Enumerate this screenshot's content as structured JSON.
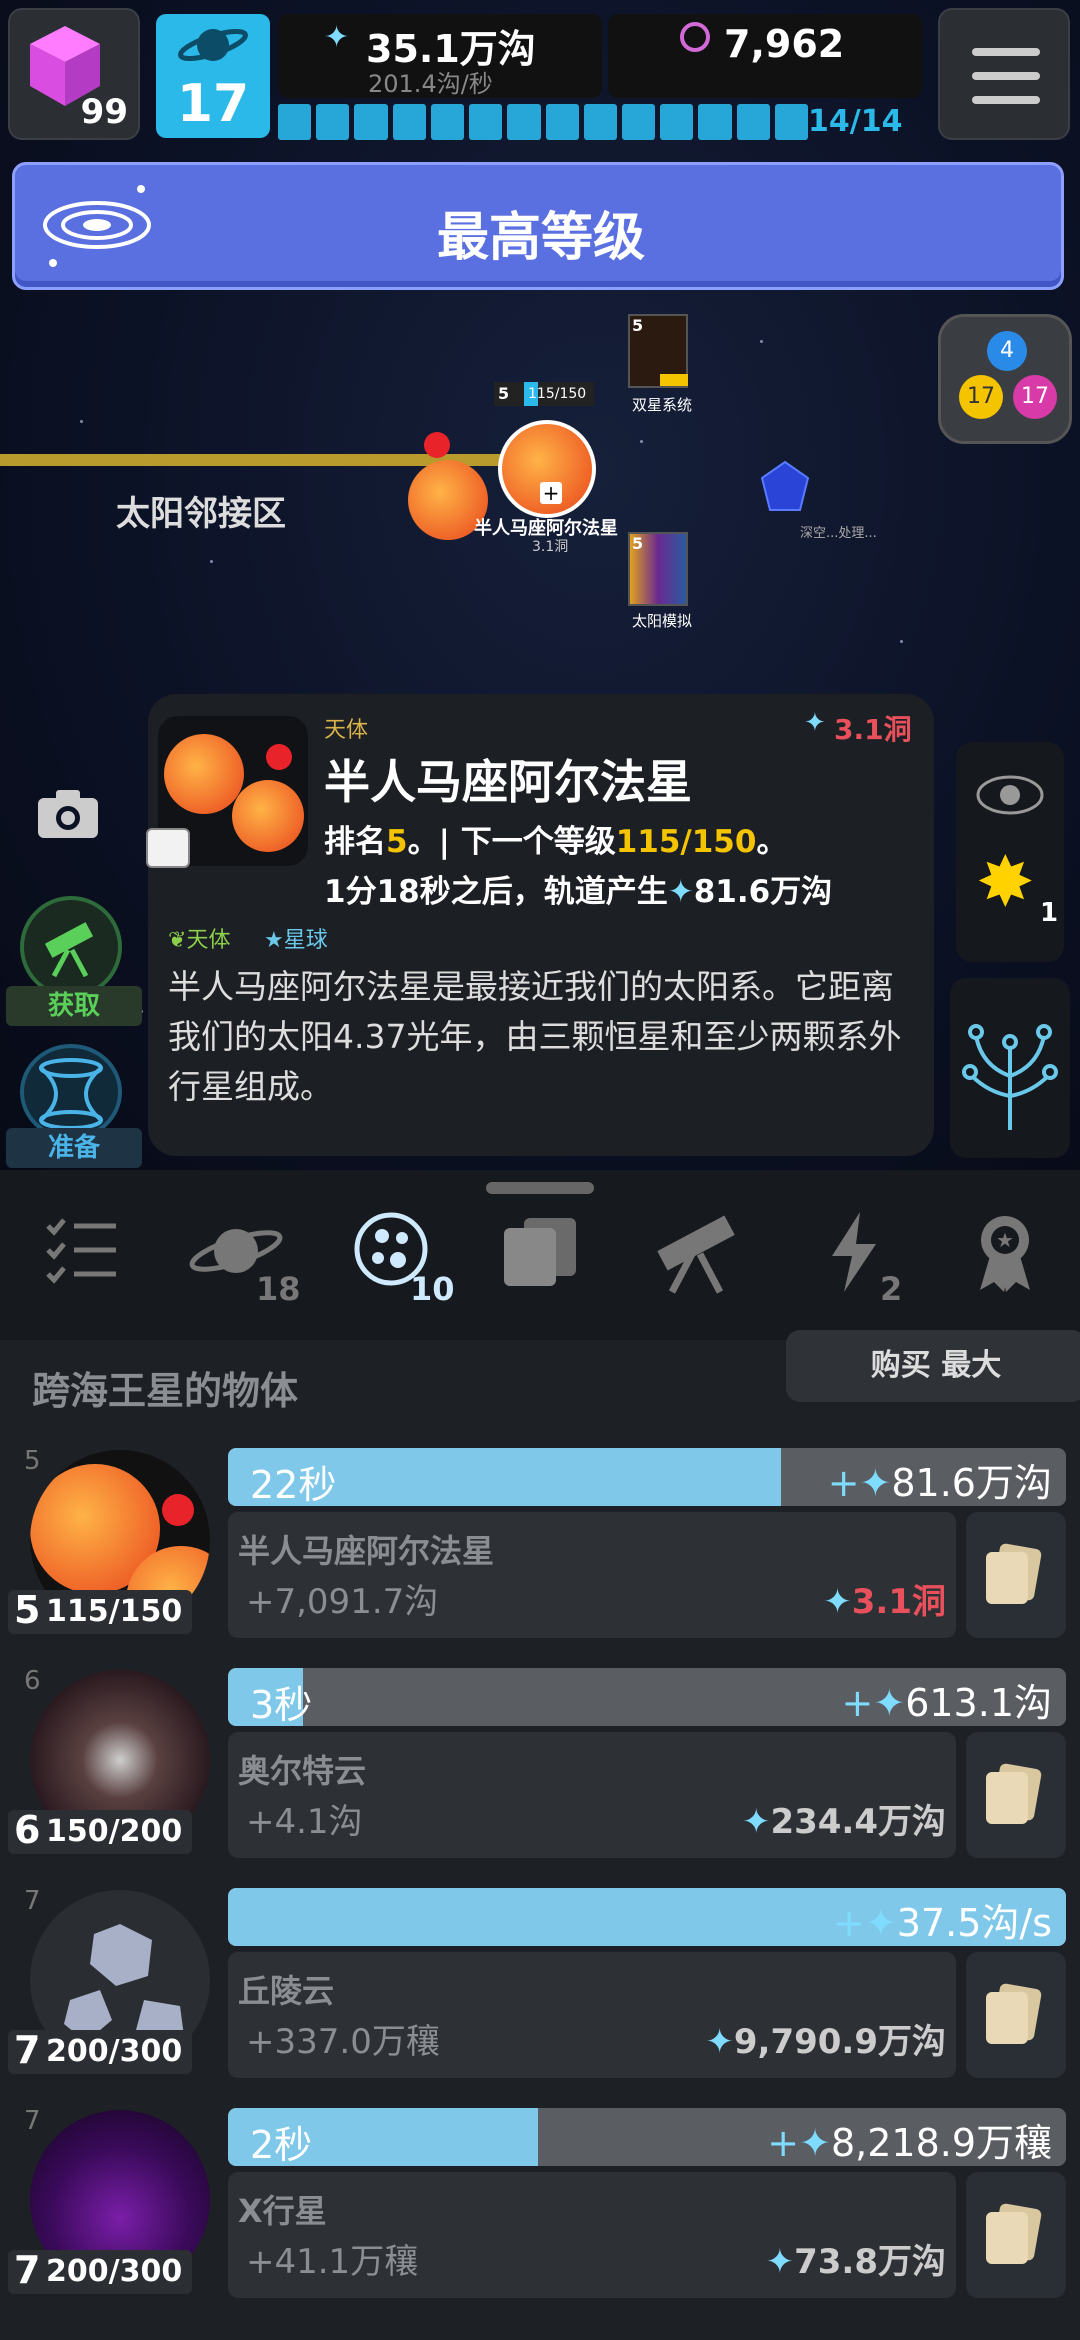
{
  "header": {
    "cube_count": "99",
    "level": "17",
    "currency_main": "35.1万沟",
    "currency_rate": "201.4沟/秒",
    "gems": "7,962",
    "progress_text": "14/14"
  },
  "banner": {
    "label": "最高等级"
  },
  "map": {
    "zone_label": "太阳邻接区",
    "node_main_label": "半人马座阿尔法星",
    "node_main_sub": "3.1洞",
    "node_main_level": "5",
    "node_main_progress": "115/150",
    "node_binary_label": "双星系统",
    "node_binary_level": "5",
    "node_solar_label": "太阳模拟",
    "node_solar_level": "5",
    "node_deep_label": "深空...处理...",
    "bubble_a": "4",
    "bubble_b": "17",
    "bubble_c": "17"
  },
  "left_actions": {
    "acquire_label": "获取",
    "prepare_label": "准备"
  },
  "detail": {
    "category": "天体",
    "cost": "3.1洞",
    "title": "半人马座阿尔法星",
    "rank_prefix": "排名",
    "rank_value": "5",
    "rank_mid": "。| 下一个等级",
    "next_level": "115/150",
    "rank_suffix": "。",
    "orbit_text_pre": "1分18秒之后，轨道产生",
    "orbit_value": "81.6万沟",
    "tag1": "天体",
    "tag2": "星球",
    "description": "半人马座阿尔法星是最接近我们的太阳系。它距离我们的太阳4.37光年，由三颗恒星和至少两颗系外行星组成。"
  },
  "right_actions": {
    "sun_count": "1"
  },
  "tabs": {
    "planet_count": "18",
    "active_count": "10",
    "lightning_count": "2"
  },
  "section": {
    "title": "跨海王星的物体",
    "buy_label": "购买 最大"
  },
  "rows": [
    {
      "rank": "5",
      "level": "5",
      "progress": "115/150",
      "timer": "22秒",
      "timer_fill": 0.66,
      "reward": "81.6万沟",
      "name": "半人马座阿尔法星",
      "income": "+7,091.7沟",
      "cost": "3.1洞"
    },
    {
      "rank": "6",
      "level": "6",
      "progress": "150/200",
      "timer": "3秒",
      "timer_fill": 0.09,
      "reward": "613.1沟",
      "name": "奥尔特云",
      "income": "+4.1沟",
      "cost": "234.4万沟"
    },
    {
      "rank": "7",
      "level": "7",
      "progress": "200/300",
      "timer": "",
      "timer_fill": 1.0,
      "reward": "37.5沟/s",
      "name": "丘陵云",
      "income": "+337.0万穰",
      "cost": "9,790.9万沟"
    },
    {
      "rank": "7",
      "level": "7",
      "progress": "200/300",
      "timer": "2秒",
      "timer_fill": 0.37,
      "reward": "8,218.9万穰",
      "name": "X行星",
      "income": "+41.1万穰",
      "cost": "73.8万沟"
    }
  ],
  "colors": {
    "accent": "#2ab9e8",
    "banner": "#5a6fe0",
    "gold": "#f5c400",
    "cost_red": "#e8505b"
  }
}
